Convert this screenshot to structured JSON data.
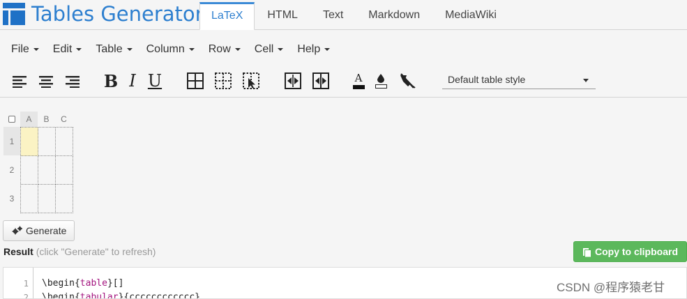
{
  "app": {
    "name": "Tables Generator"
  },
  "tabs": [
    {
      "label": "LaTeX",
      "active": true
    },
    {
      "label": "HTML",
      "active": false
    },
    {
      "label": "Text",
      "active": false
    },
    {
      "label": "Markdown",
      "active": false
    },
    {
      "label": "MediaWiki",
      "active": false
    }
  ],
  "menu": [
    "File",
    "Edit",
    "Table",
    "Column",
    "Row",
    "Cell",
    "Help"
  ],
  "toolbar": {
    "buttons": [
      "align-left-icon",
      "align-center-icon",
      "align-right-icon",
      "bold-icon",
      "italic-icon",
      "underline-icon",
      "all-borders-icon",
      "dashed-borders-icon",
      "border-select-icon",
      "merge-cells-icon",
      "split-cells-icon",
      "text-color-icon",
      "background-color-icon",
      "clear-formatting-icon"
    ],
    "bold_label": "B",
    "italic_label": "I",
    "underline_label": "U",
    "text_color_label": "A",
    "table_style": "Default table style"
  },
  "grid": {
    "columns": [
      "A",
      "B",
      "C"
    ],
    "rows": [
      "1",
      "2",
      "3"
    ],
    "selected_cell": "A1"
  },
  "generate_label": "Generate",
  "result": {
    "label": "Result",
    "hint": "(click \"Generate\" to refresh)"
  },
  "copy_label": "Copy to clipboard",
  "code": {
    "lines": [
      {
        "num": "1",
        "cmd": "\\begin",
        "arg": "table",
        "tail": "[]"
      },
      {
        "num": "2",
        "cmd": "\\begin",
        "arg": "tabular",
        "tail": "{cccccccccccc}"
      }
    ]
  },
  "watermark": "CSDN @程序猿老甘",
  "colors": {
    "brand_blue": "#1f71c6",
    "accent_green": "#5cb85c",
    "selected_cell": "#fbf3c4"
  }
}
